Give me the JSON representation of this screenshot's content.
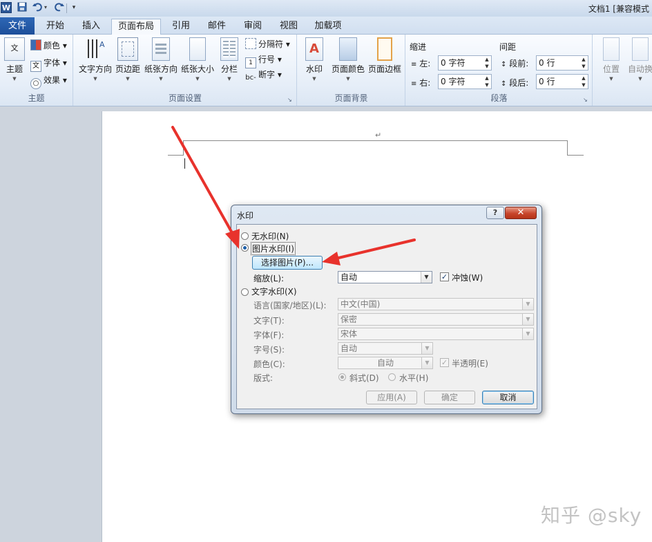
{
  "titlebar": {
    "app_logo": "W",
    "window_title": "文档1 [兼容模式"
  },
  "tabs": {
    "file": "文件",
    "items": [
      "开始",
      "插入",
      "页面布局",
      "引用",
      "邮件",
      "审阅",
      "视图",
      "加载项"
    ],
    "active": "页面布局"
  },
  "ribbon": {
    "theme_group": {
      "label": "主题",
      "themes_button": "主题",
      "colors": "颜色",
      "fonts": "字体",
      "effects": "效果"
    },
    "page_setup_group": {
      "label": "页面设置",
      "text_direction": "文字方向",
      "margins": "页边距",
      "orientation": "纸张方向",
      "size": "纸张大小",
      "columns": "分栏",
      "breaks": "分隔符",
      "line_numbers": "行号",
      "hyphenation": "断字"
    },
    "page_background_group": {
      "label": "页面背景",
      "watermark": "水印",
      "page_color": "页面颜色",
      "page_borders": "页面边框"
    },
    "paragraph_group": {
      "label": "段落",
      "indent_title": "缩进",
      "spacing_title": "间距",
      "left_label": "左:",
      "left_value": "0 字符",
      "right_label": "右:",
      "right_value": "0 字符",
      "before_label": "段前:",
      "before_value": "0 行",
      "after_label": "段后:",
      "after_value": "0 行"
    },
    "arrange_group": {
      "position": "位置",
      "wrap_text": "自动换"
    }
  },
  "dialog": {
    "title": "水印",
    "help": "?",
    "close": "✕",
    "no_watermark": "无水印(N)",
    "picture_watermark": "图片水印(I)",
    "select_picture": "选择图片(P)...",
    "scale_label": "缩放(L):",
    "scale_value": "自动",
    "washout_label": "冲蚀(W)",
    "washout_checked": true,
    "text_watermark": "文字水印(X)",
    "language_label": "语言(国家/地区)(L):",
    "language_value": "中文(中国)",
    "text_label": "文字(T):",
    "text_value": "保密",
    "font_label": "字体(F):",
    "font_value": "宋体",
    "size_label": "字号(S):",
    "size_value": "自动",
    "color_label": "颜色(C):",
    "color_value": "自动",
    "semitransparent_label": "半透明(E)",
    "semitransparent_checked": true,
    "layout_label": "版式:",
    "layout_diagonal": "斜式(D)",
    "layout_horizontal": "水平(H)",
    "apply": "应用(A)",
    "ok": "确定",
    "cancel": "取消",
    "selected_option": "picture"
  },
  "document": {
    "paragraph_mark": "↵"
  },
  "watermark_text": "知乎 @sky",
  "colors": {
    "file_tab": "#2b5797",
    "arrow": "#e8322c",
    "close_button": "#c8452c"
  }
}
